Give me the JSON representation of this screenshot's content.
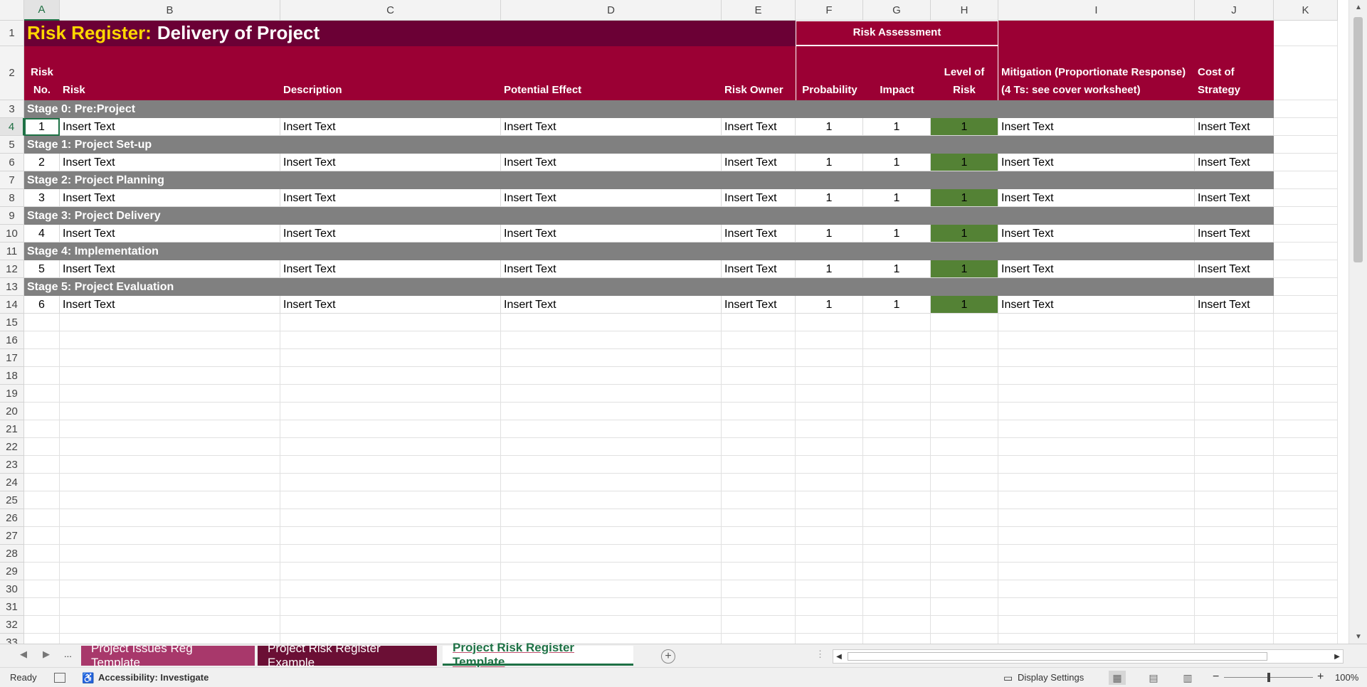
{
  "columns": [
    "A",
    "B",
    "C",
    "D",
    "E",
    "F",
    "G",
    "H",
    "I",
    "J",
    "K"
  ],
  "rows_visible": [
    "1",
    "2",
    "3",
    "4",
    "5",
    "6",
    "7",
    "8",
    "9",
    "10",
    "11",
    "12",
    "13",
    "14",
    "15",
    "16",
    "17",
    "18",
    "19",
    "20",
    "21",
    "22",
    "23",
    "24",
    "25",
    "26",
    "27",
    "28",
    "29",
    "30",
    "31",
    "32",
    "33"
  ],
  "selected_cell": "A4",
  "title": {
    "prefix": "Risk Register:",
    "main": "Delivery of Project"
  },
  "group_header": "Risk Assessment",
  "headers": {
    "risk_no": "Risk No.",
    "risk": "Risk",
    "description": "Description",
    "potential_effect": "Potential Effect",
    "risk_owner": "Risk Owner",
    "probability": "Probability",
    "impact": "Impact",
    "level_of_risk": "Level of Risk",
    "mitigation": "Mitigation (Proportionate Response) (4 Ts: see cover worksheet)",
    "cost": "Cost of Strategy"
  },
  "stages": [
    {
      "label": "Stage 0: Pre:Project",
      "risk": {
        "no": "1",
        "risk": "Insert Text",
        "description": "Insert Text",
        "effect": "Insert Text",
        "owner": "Insert Text",
        "probability": "1",
        "impact": "1",
        "level": "1",
        "mitigation": "Insert Text",
        "cost": "Insert Text"
      }
    },
    {
      "label": "Stage 1: Project Set-up",
      "risk": {
        "no": "2",
        "risk": "Insert Text",
        "description": "Insert Text",
        "effect": "Insert Text",
        "owner": "Insert Text",
        "probability": "1",
        "impact": "1",
        "level": "1",
        "mitigation": "Insert Text",
        "cost": "Insert Text"
      }
    },
    {
      "label": "Stage 2: Project Planning",
      "risk": {
        "no": "3",
        "risk": "Insert Text",
        "description": "Insert Text",
        "effect": "Insert Text",
        "owner": "Insert Text",
        "probability": "1",
        "impact": "1",
        "level": "1",
        "mitigation": "Insert Text",
        "cost": "Insert Text"
      }
    },
    {
      "label": "Stage 3: Project Delivery",
      "risk": {
        "no": "4",
        "risk": "Insert Text",
        "description": "Insert Text",
        "effect": "Insert Text",
        "owner": "Insert Text",
        "probability": "1",
        "impact": "1",
        "level": "1",
        "mitigation": "Insert Text",
        "cost": "Insert Text"
      }
    },
    {
      "label": "Stage 4: Implementation",
      "risk": {
        "no": "5",
        "risk": "Insert Text",
        "description": "Insert Text",
        "effect": "Insert Text",
        "owner": "Insert Text",
        "probability": "1",
        "impact": "1",
        "level": "1",
        "mitigation": "Insert Text",
        "cost": "Insert Text"
      }
    },
    {
      "label": "Stage 5: Project Evaluation",
      "risk": {
        "no": "6",
        "risk": "Insert Text",
        "description": "Insert Text",
        "effect": "Insert Text",
        "owner": "Insert Text",
        "probability": "1",
        "impact": "1",
        "level": "1",
        "mitigation": "Insert Text",
        "cost": "Insert Text"
      }
    }
  ],
  "colors": {
    "header": "#9b0034",
    "title_bar": "#6b0035",
    "title_prefix": "#ffd700",
    "stage_bg": "#808080",
    "level_low": "#548235",
    "accent": "#1e7145"
  },
  "tabs": [
    {
      "label": "Project Issues Reg Template",
      "active": false
    },
    {
      "label": "Project Risk Register Example",
      "active": false
    },
    {
      "label": "Project Risk Register Template",
      "active": true
    }
  ],
  "tab_nav": {
    "prev": "◀",
    "next": "▶",
    "more": "..."
  },
  "status": {
    "ready": "Ready",
    "accessibility": "Accessibility: Investigate",
    "display_settings": "Display Settings",
    "zoom": "100%",
    "zoom_minus": "−",
    "zoom_plus": "+"
  }
}
